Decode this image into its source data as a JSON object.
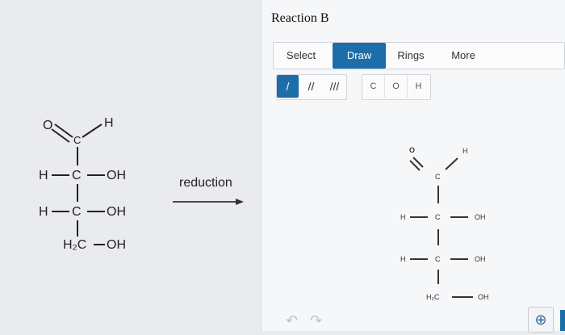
{
  "left": {
    "atom_o": "O",
    "atom_c_top": "C",
    "atom_h_top": "H",
    "row1": {
      "h": "H",
      "c": "C",
      "oh": "OH"
    },
    "row2": {
      "h": "H",
      "c": "C",
      "oh": "OH"
    },
    "row3": {
      "h2c": "H₂C",
      "oh": "OH"
    },
    "arrow_label": "reduction"
  },
  "panel": {
    "title": "Reaction B",
    "tabs": [
      {
        "label": "Select"
      },
      {
        "label": "Draw"
      },
      {
        "label": "Rings"
      },
      {
        "label": "More"
      }
    ],
    "bonds": [
      {
        "symbol": "/"
      },
      {
        "symbol": "//"
      },
      {
        "symbol": "///"
      }
    ],
    "atoms": [
      {
        "label": "C"
      },
      {
        "label": "O"
      },
      {
        "label": "H"
      }
    ],
    "drawn": {
      "o": "O",
      "h_top": "H",
      "c_top": "C",
      "r1": {
        "h": "H",
        "c": "C",
        "oh": "OH"
      },
      "r2": {
        "h": "H",
        "c": "C",
        "oh": "OH"
      },
      "r3": {
        "h2c": "H₂C",
        "oh": "OH"
      }
    }
  },
  "icons": {
    "undo": "undo-icon",
    "redo": "redo-icon",
    "zoom": "zoom-in-icon"
  },
  "colors": {
    "accent": "#1d6ea8"
  }
}
